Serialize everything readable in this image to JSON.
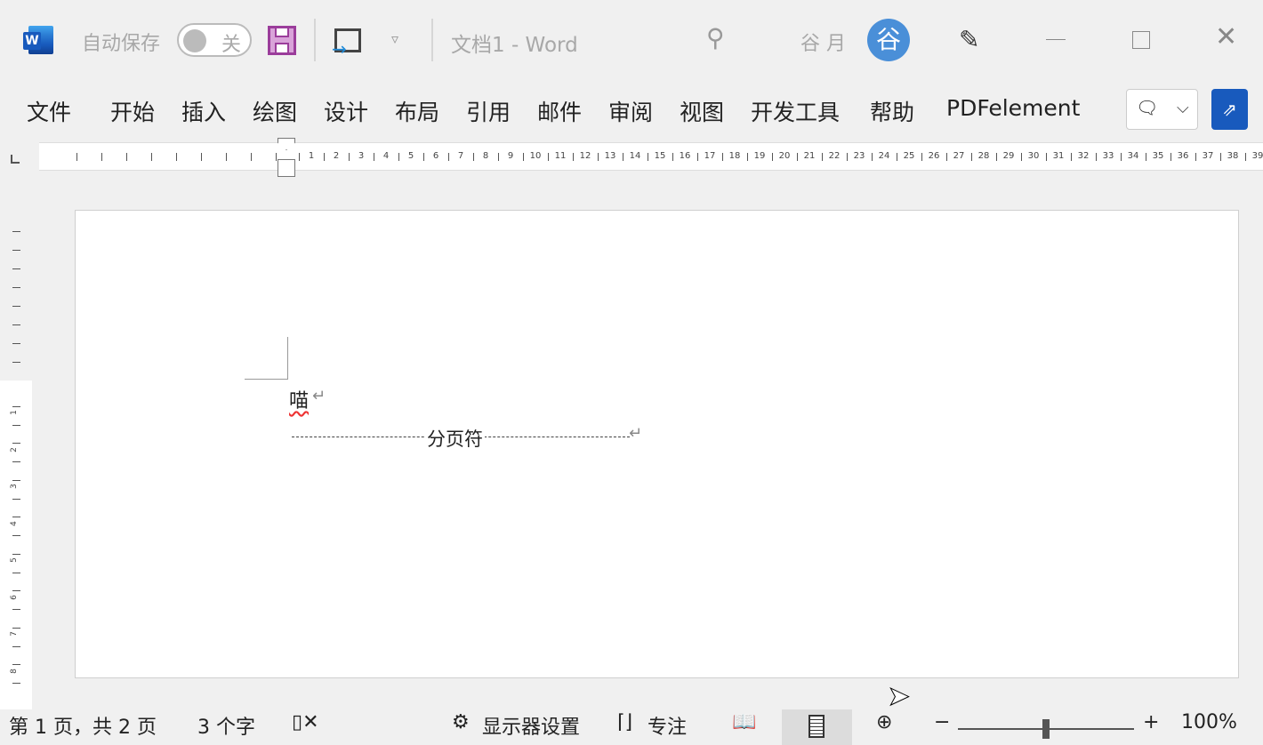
{
  "titlebar": {
    "autosave_label": "自动保存",
    "autosave_state": "关",
    "doc_title": "文档1  -  Word",
    "user_name": "谷 月",
    "avatar_text": "谷"
  },
  "ribbon_tabs": [
    "文件",
    "开始",
    "插入",
    "绘图",
    "设计",
    "布局",
    "引用",
    "邮件",
    "审阅",
    "视图",
    "开发工具",
    "帮助",
    "PDFelement"
  ],
  "ruler": {
    "h_numbers": [
      "1",
      "2",
      "3",
      "4",
      "5",
      "6",
      "7",
      "8",
      "9",
      "10",
      "11",
      "12",
      "13",
      "14",
      "15",
      "16",
      "17",
      "18",
      "19",
      "20",
      "21",
      "22",
      "23",
      "24",
      "25",
      "26",
      "27",
      "28",
      "29",
      "30",
      "31",
      "32",
      "33",
      "34",
      "35",
      "36",
      "37",
      "38",
      "39"
    ],
    "v_numbers": [
      "1",
      "2",
      "3",
      "4",
      "5",
      "6",
      "7",
      "8"
    ]
  },
  "document": {
    "line1": "喵",
    "page_break_label": "分页符"
  },
  "status": {
    "page": "第 1 页，共 2 页",
    "words": "3 个字",
    "display_settings": "显示器设置",
    "focus": "专注",
    "zoom": "100%",
    "zoom_minus": "−",
    "zoom_plus": "+",
    "zoom_level": 0.5
  },
  "colors": {
    "accent": "#185abd",
    "save_icon": "#9b3d9b",
    "avatar": "#4a8fd8"
  }
}
